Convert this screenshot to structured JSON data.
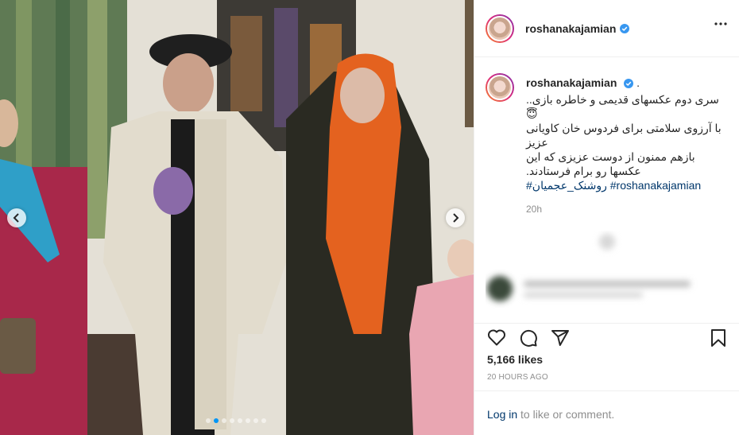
{
  "post": {
    "username": "roshanakajamian",
    "caption_username": "roshanakajamian",
    "caption_dot": ".",
    "caption_lines": [
      "..سری دوم عکسهای قدیمی و خاطره بازی",
      "😇",
      "با آرزوی سلامتی برای فردوس خان کاویانی",
      "عزیز",
      "بازهم ممنون از دوست عزیزی که این",
      ".عکسها رو برام فرستادند"
    ],
    "hashtag_fa": "#روشنک_عجمیان",
    "hashtag_en": "#roshanakajamian",
    "time_ago": "20h",
    "likes": "5,166 likes",
    "posted_label": "20 HOURS AGO",
    "login_link": "Log in",
    "login_suffix": " to like or comment."
  },
  "carousel": {
    "total_slides": 8,
    "active_index": 1
  },
  "icons": {
    "verified": "verified-badge-icon",
    "more": "more-options-icon",
    "like": "heart-icon",
    "comment": "comment-icon",
    "share": "paper-plane-icon",
    "save": "bookmark-icon",
    "prev": "chevron-left-icon",
    "next": "chevron-right-icon"
  },
  "colors": {
    "verified": "#3897f0",
    "link": "#00376b",
    "muted": "#8e8e8e",
    "active_dot": "#0095f6"
  }
}
